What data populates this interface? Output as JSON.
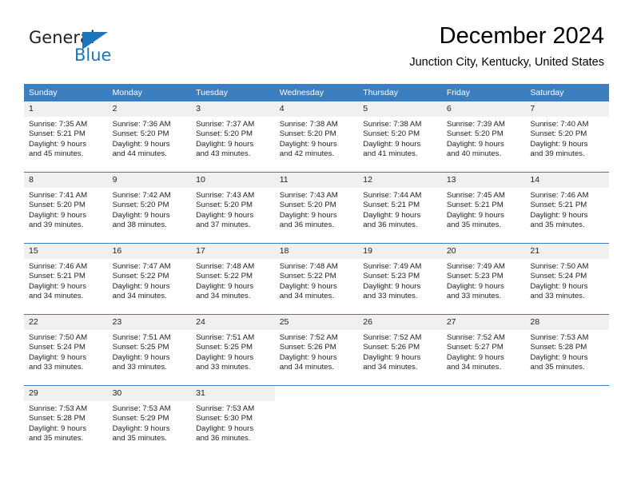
{
  "logo": {
    "word_top": "General",
    "word_bottom": "Blue",
    "triangle_color": "#1b75bb",
    "icon": "general-blue-logo"
  },
  "header": {
    "title": "December 2024",
    "subtitle": "Junction City, Kentucky, United States"
  },
  "colors": {
    "header_blue": "#3c7ebf",
    "daynum_band": "#f0f0f0",
    "text": "#222222"
  },
  "weekdays": [
    "Sunday",
    "Monday",
    "Tuesday",
    "Wednesday",
    "Thursday",
    "Friday",
    "Saturday"
  ],
  "weeks": [
    [
      {
        "day": "1",
        "sunrise": "Sunrise: 7:35 AM",
        "sunset": "Sunset: 5:21 PM",
        "daylight_1": "Daylight: 9 hours",
        "daylight_2": "and 45 minutes."
      },
      {
        "day": "2",
        "sunrise": "Sunrise: 7:36 AM",
        "sunset": "Sunset: 5:20 PM",
        "daylight_1": "Daylight: 9 hours",
        "daylight_2": "and 44 minutes."
      },
      {
        "day": "3",
        "sunrise": "Sunrise: 7:37 AM",
        "sunset": "Sunset: 5:20 PM",
        "daylight_1": "Daylight: 9 hours",
        "daylight_2": "and 43 minutes."
      },
      {
        "day": "4",
        "sunrise": "Sunrise: 7:38 AM",
        "sunset": "Sunset: 5:20 PM",
        "daylight_1": "Daylight: 9 hours",
        "daylight_2": "and 42 minutes."
      },
      {
        "day": "5",
        "sunrise": "Sunrise: 7:38 AM",
        "sunset": "Sunset: 5:20 PM",
        "daylight_1": "Daylight: 9 hours",
        "daylight_2": "and 41 minutes."
      },
      {
        "day": "6",
        "sunrise": "Sunrise: 7:39 AM",
        "sunset": "Sunset: 5:20 PM",
        "daylight_1": "Daylight: 9 hours",
        "daylight_2": "and 40 minutes."
      },
      {
        "day": "7",
        "sunrise": "Sunrise: 7:40 AM",
        "sunset": "Sunset: 5:20 PM",
        "daylight_1": "Daylight: 9 hours",
        "daylight_2": "and 39 minutes."
      }
    ],
    [
      {
        "day": "8",
        "sunrise": "Sunrise: 7:41 AM",
        "sunset": "Sunset: 5:20 PM",
        "daylight_1": "Daylight: 9 hours",
        "daylight_2": "and 39 minutes."
      },
      {
        "day": "9",
        "sunrise": "Sunrise: 7:42 AM",
        "sunset": "Sunset: 5:20 PM",
        "daylight_1": "Daylight: 9 hours",
        "daylight_2": "and 38 minutes."
      },
      {
        "day": "10",
        "sunrise": "Sunrise: 7:43 AM",
        "sunset": "Sunset: 5:20 PM",
        "daylight_1": "Daylight: 9 hours",
        "daylight_2": "and 37 minutes."
      },
      {
        "day": "11",
        "sunrise": "Sunrise: 7:43 AM",
        "sunset": "Sunset: 5:20 PM",
        "daylight_1": "Daylight: 9 hours",
        "daylight_2": "and 36 minutes."
      },
      {
        "day": "12",
        "sunrise": "Sunrise: 7:44 AM",
        "sunset": "Sunset: 5:21 PM",
        "daylight_1": "Daylight: 9 hours",
        "daylight_2": "and 36 minutes."
      },
      {
        "day": "13",
        "sunrise": "Sunrise: 7:45 AM",
        "sunset": "Sunset: 5:21 PM",
        "daylight_1": "Daylight: 9 hours",
        "daylight_2": "and 35 minutes."
      },
      {
        "day": "14",
        "sunrise": "Sunrise: 7:46 AM",
        "sunset": "Sunset: 5:21 PM",
        "daylight_1": "Daylight: 9 hours",
        "daylight_2": "and 35 minutes."
      }
    ],
    [
      {
        "day": "15",
        "sunrise": "Sunrise: 7:46 AM",
        "sunset": "Sunset: 5:21 PM",
        "daylight_1": "Daylight: 9 hours",
        "daylight_2": "and 34 minutes."
      },
      {
        "day": "16",
        "sunrise": "Sunrise: 7:47 AM",
        "sunset": "Sunset: 5:22 PM",
        "daylight_1": "Daylight: 9 hours",
        "daylight_2": "and 34 minutes."
      },
      {
        "day": "17",
        "sunrise": "Sunrise: 7:48 AM",
        "sunset": "Sunset: 5:22 PM",
        "daylight_1": "Daylight: 9 hours",
        "daylight_2": "and 34 minutes."
      },
      {
        "day": "18",
        "sunrise": "Sunrise: 7:48 AM",
        "sunset": "Sunset: 5:22 PM",
        "daylight_1": "Daylight: 9 hours",
        "daylight_2": "and 34 minutes."
      },
      {
        "day": "19",
        "sunrise": "Sunrise: 7:49 AM",
        "sunset": "Sunset: 5:23 PM",
        "daylight_1": "Daylight: 9 hours",
        "daylight_2": "and 33 minutes."
      },
      {
        "day": "20",
        "sunrise": "Sunrise: 7:49 AM",
        "sunset": "Sunset: 5:23 PM",
        "daylight_1": "Daylight: 9 hours",
        "daylight_2": "and 33 minutes."
      },
      {
        "day": "21",
        "sunrise": "Sunrise: 7:50 AM",
        "sunset": "Sunset: 5:24 PM",
        "daylight_1": "Daylight: 9 hours",
        "daylight_2": "and 33 minutes."
      }
    ],
    [
      {
        "day": "22",
        "sunrise": "Sunrise: 7:50 AM",
        "sunset": "Sunset: 5:24 PM",
        "daylight_1": "Daylight: 9 hours",
        "daylight_2": "and 33 minutes."
      },
      {
        "day": "23",
        "sunrise": "Sunrise: 7:51 AM",
        "sunset": "Sunset: 5:25 PM",
        "daylight_1": "Daylight: 9 hours",
        "daylight_2": "and 33 minutes."
      },
      {
        "day": "24",
        "sunrise": "Sunrise: 7:51 AM",
        "sunset": "Sunset: 5:25 PM",
        "daylight_1": "Daylight: 9 hours",
        "daylight_2": "and 33 minutes."
      },
      {
        "day": "25",
        "sunrise": "Sunrise: 7:52 AM",
        "sunset": "Sunset: 5:26 PM",
        "daylight_1": "Daylight: 9 hours",
        "daylight_2": "and 34 minutes."
      },
      {
        "day": "26",
        "sunrise": "Sunrise: 7:52 AM",
        "sunset": "Sunset: 5:26 PM",
        "daylight_1": "Daylight: 9 hours",
        "daylight_2": "and 34 minutes."
      },
      {
        "day": "27",
        "sunrise": "Sunrise: 7:52 AM",
        "sunset": "Sunset: 5:27 PM",
        "daylight_1": "Daylight: 9 hours",
        "daylight_2": "and 34 minutes."
      },
      {
        "day": "28",
        "sunrise": "Sunrise: 7:53 AM",
        "sunset": "Sunset: 5:28 PM",
        "daylight_1": "Daylight: 9 hours",
        "daylight_2": "and 35 minutes."
      }
    ],
    [
      {
        "day": "29",
        "sunrise": "Sunrise: 7:53 AM",
        "sunset": "Sunset: 5:28 PM",
        "daylight_1": "Daylight: 9 hours",
        "daylight_2": "and 35 minutes."
      },
      {
        "day": "30",
        "sunrise": "Sunrise: 7:53 AM",
        "sunset": "Sunset: 5:29 PM",
        "daylight_1": "Daylight: 9 hours",
        "daylight_2": "and 35 minutes."
      },
      {
        "day": "31",
        "sunrise": "Sunrise: 7:53 AM",
        "sunset": "Sunset: 5:30 PM",
        "daylight_1": "Daylight: 9 hours",
        "daylight_2": "and 36 minutes."
      },
      {
        "day": "",
        "sunrise": "",
        "sunset": "",
        "daylight_1": "",
        "daylight_2": ""
      },
      {
        "day": "",
        "sunrise": "",
        "sunset": "",
        "daylight_1": "",
        "daylight_2": ""
      },
      {
        "day": "",
        "sunrise": "",
        "sunset": "",
        "daylight_1": "",
        "daylight_2": ""
      },
      {
        "day": "",
        "sunrise": "",
        "sunset": "",
        "daylight_1": "",
        "daylight_2": ""
      }
    ]
  ]
}
